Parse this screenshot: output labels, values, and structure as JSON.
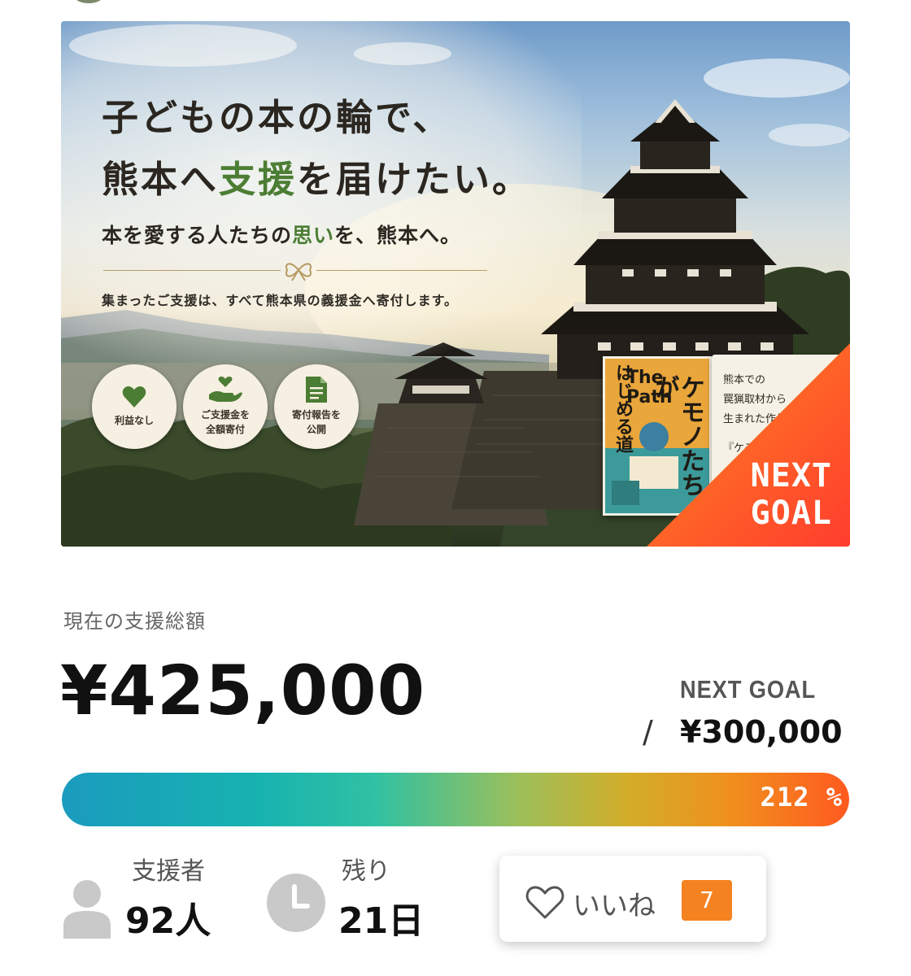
{
  "banner": {
    "headline_part1": "子どもの本の輪で、",
    "headline_part2a": "熊本へ",
    "headline_part2b": "支援",
    "headline_part2c": "を届けたい。",
    "subhead_a": "本を愛する人たちの",
    "subhead_b": "思い",
    "subhead_c": "を、熊本へ。",
    "note": "集まったご支援は、すべて熊本県の義援金へ寄付します。",
    "badges": [
      {
        "icon": "heart-icon",
        "label": "利益なし"
      },
      {
        "icon": "hand-heart-icon",
        "label": "ご支援金を\n全額寄付"
      },
      {
        "icon": "document-icon",
        "label": "寄付報告を\n公開"
      }
    ],
    "book": {
      "title": "ケモノたちが",
      "subtitle": "はじめる道",
      "english": "The Path"
    },
    "book_card_lines": [
      "熊本での",
      "罠猟取材から",
      "生まれた作品",
      "『ケモノ"
    ],
    "corner_label": "NEXT\nGOAL",
    "colors": {
      "accent_green": "#4c7d34",
      "corner_start": "#ff8a1f",
      "corner_end": "#ff3d2e"
    }
  },
  "funding": {
    "total_label": "現在の支援総額",
    "total_amount": "¥425,000",
    "next_goal_label": "NEXT GOAL",
    "slash": "/",
    "next_goal_amount": "¥300,000",
    "progress_percent": 212,
    "progress_text": "212 %"
  },
  "stats": {
    "supporters_label": "支援者",
    "supporters_value": "92人",
    "remaining_label": "残り",
    "remaining_value": "21日"
  },
  "like": {
    "label": "いいね",
    "count": "7",
    "count_color": "#f58220"
  }
}
